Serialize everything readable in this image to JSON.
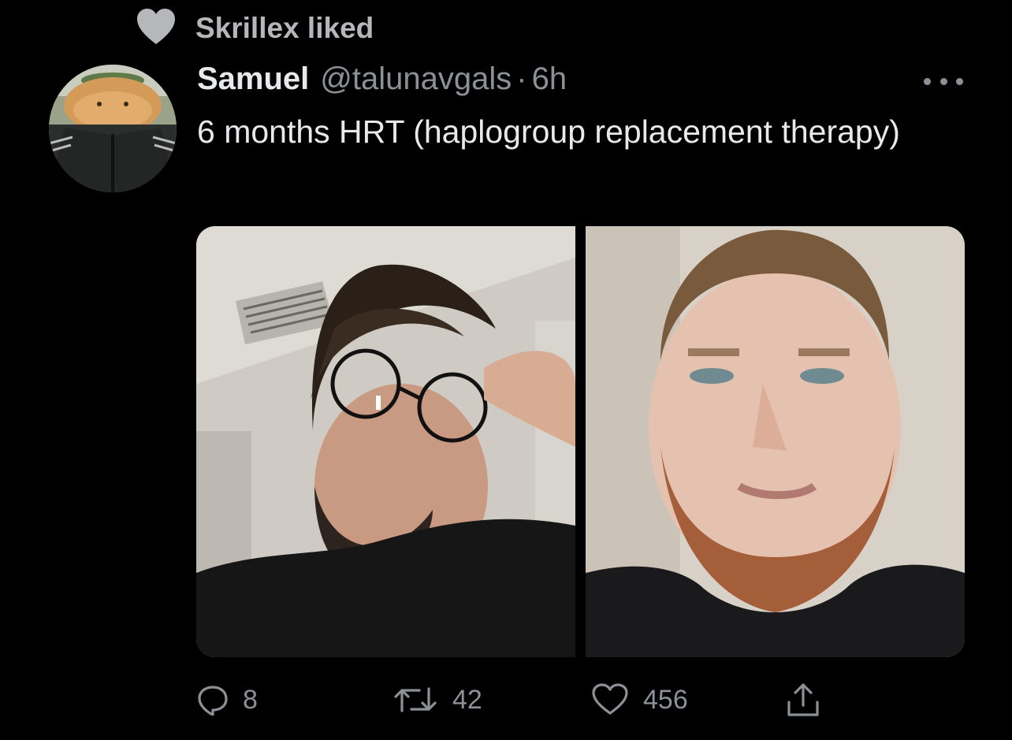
{
  "social_context": {
    "text": "Skrillex liked",
    "icon": "heart-icon"
  },
  "tweet": {
    "author_name": "Samuel",
    "author_handle": "@talunavgals",
    "separator": "·",
    "time": "6h",
    "text": "6 months HRT (haplogroup replacement therapy)",
    "avatar": "cat-avatar",
    "more_icon": "more-icon"
  },
  "media": {
    "photos": [
      {
        "name": "photo-dark-haired-man-glasses"
      },
      {
        "name": "photo-ginger-bearded-man"
      }
    ]
  },
  "actions": {
    "reply_count": "8",
    "retweet_count": "42",
    "like_count": "456"
  },
  "colors": {
    "background": "#000000",
    "text_primary": "#e7e9ea",
    "text_secondary": "#8b9196"
  }
}
